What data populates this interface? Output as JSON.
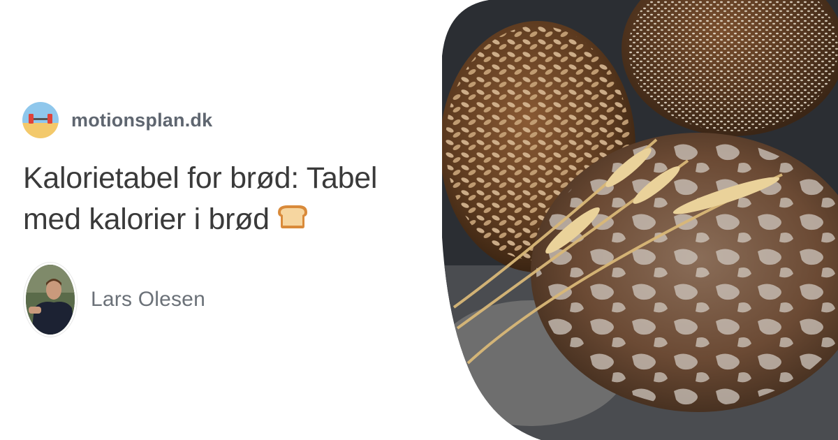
{
  "site": {
    "name": "motionsplan.dk",
    "logo_icon": "dumbbell-beach-icon"
  },
  "article": {
    "title": "Kalorietabel for brød: Tabel med kalorier i brød",
    "title_emoji_icon": "bread-icon"
  },
  "author": {
    "name": "Lars Olesen",
    "avatar_icon": "author-photo"
  },
  "hero": {
    "subject": "bread-loaves-with-wheat-photo"
  },
  "colors": {
    "text_dark": "#3a3a3a",
    "text_muted": "#5f6670",
    "background": "#ffffff"
  }
}
